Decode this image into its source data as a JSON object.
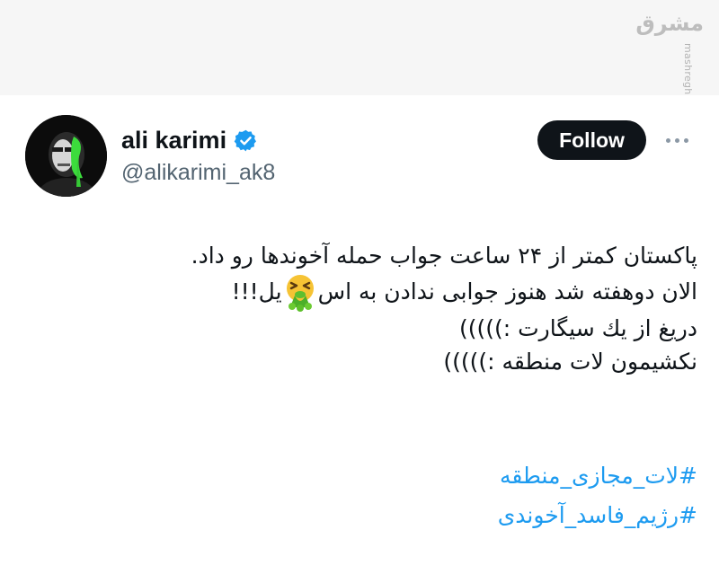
{
  "watermark": {
    "logo_text": "مشرق",
    "url": "mashreghnews.ir"
  },
  "tweet": {
    "author": {
      "display_name": "ali karimi",
      "handle": "@alikarimi_ak8",
      "verified": true
    },
    "follow_label": "Follow",
    "more_icon": "more-options-icon",
    "text_lines": [
      "پاکستان کمتر از ۲۴ ساعت جواب حمله آخوندها رو داد.",
      "الان دوهفته شد هنوز جوابی ندادن به اسرائیل!!!",
      "دریغ از یك سیگارت :)))))",
      "نکشیمون لات منطقه :)))))"
    ],
    "line2_before_emoji": "الان دوهفته شد هنوز جوابی ندادن به اس",
    "line2_after_emoji": "یل!!!",
    "emoji_name": "face-vomiting-emoji",
    "hashtags": [
      "#لات_مجازی_منطقه",
      "#رژیم_فاسد_آخوندی"
    ]
  },
  "colors": {
    "follow_bg": "#0f1419",
    "link": "#1d9bf0",
    "verified": "#1d9bf0",
    "handle": "#536471"
  }
}
